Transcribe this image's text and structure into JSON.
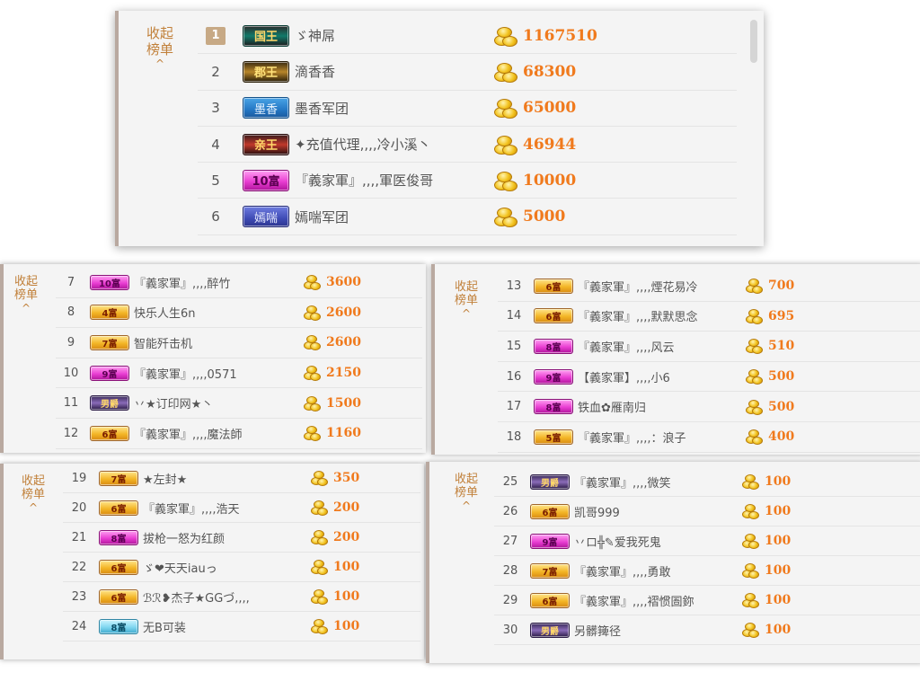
{
  "collapse_label": "收起\n榜单",
  "collapse_text1": "收起",
  "collapse_text2": "榜单",
  "collapse_arrow": "^",
  "colors": {
    "amount": "#f07a1d",
    "rank1_bg": "#c7a985",
    "collapse": "#c1803a"
  },
  "panels": [
    {
      "rows": [
        {
          "rank": "1",
          "badge": "国王",
          "badge_style": "teal",
          "name": "ゞ神屌",
          "amount": "1167510"
        },
        {
          "rank": "2",
          "badge": "郡王",
          "badge_style": "gold2",
          "name": "滴香香",
          "amount": "68300"
        },
        {
          "rank": "3",
          "badge": "墨香",
          "badge_style": "blue",
          "name": "墨香军团",
          "amount": "65000"
        },
        {
          "rank": "4",
          "badge": "亲王",
          "badge_style": "red",
          "name": "✦充值代理,,,,冷小溪丶",
          "amount": "46944"
        },
        {
          "rank": "5",
          "badge": "10富",
          "badge_style": "pink",
          "name": "『義家軍』,,,,軍医俊哥",
          "amount": "10000"
        },
        {
          "rank": "6",
          "badge": "嫣喘",
          "badge_style": "vio",
          "name": "嫣喘军团",
          "amount": "5000"
        }
      ]
    },
    {
      "rows": [
        {
          "rank": "7",
          "badge": "10富",
          "badge_style": "pink",
          "name": "『義家軍』,,,,醉竹",
          "amount": "3600"
        },
        {
          "rank": "8",
          "badge": "4富",
          "badge_style": "gold",
          "name": "快乐人生6n",
          "amount": "2600"
        },
        {
          "rank": "9",
          "badge": "7富",
          "badge_style": "gold",
          "name": "智能歼击机",
          "amount": "2600"
        },
        {
          "rank": "10",
          "badge": "9富",
          "badge_style": "pink",
          "name": "『義家軍』,,,,0571",
          "amount": "2150"
        },
        {
          "rank": "11",
          "badge": "男爵",
          "badge_style": "purp",
          "name": "丷★订印网★丶",
          "amount": "1500"
        },
        {
          "rank": "12",
          "badge": "6富",
          "badge_style": "gold",
          "name": "『義家軍』,,,,魔法師",
          "amount": "1160"
        }
      ]
    },
    {
      "rows": [
        {
          "rank": "13",
          "badge": "6富",
          "badge_style": "gold",
          "name": "『義家軍』,,,,煙花易冷",
          "amount": "700"
        },
        {
          "rank": "14",
          "badge": "6富",
          "badge_style": "gold",
          "name": "『義家軍』,,,,默默思念",
          "amount": "695"
        },
        {
          "rank": "15",
          "badge": "8富",
          "badge_style": "pink",
          "name": "『義家軍』,,,,风云",
          "amount": "510"
        },
        {
          "rank": "16",
          "badge": "9富",
          "badge_style": "pink",
          "name": "【義家軍】,,,,小6",
          "amount": "500"
        },
        {
          "rank": "17",
          "badge": "8富",
          "badge_style": "pink",
          "name": "铁血✿雁南归",
          "amount": "500"
        },
        {
          "rank": "18",
          "badge": "5富",
          "badge_style": "gold",
          "name": "『義家軍』,,,,：浪子",
          "amount": "400"
        }
      ]
    },
    {
      "rows": [
        {
          "rank": "19",
          "badge": "7富",
          "badge_style": "gold",
          "name": "★左封★",
          "amount": "350"
        },
        {
          "rank": "20",
          "badge": "6富",
          "badge_style": "gold",
          "name": "『義家軍』,,,,浩天",
          "amount": "200"
        },
        {
          "rank": "21",
          "badge": "8富",
          "badge_style": "pink",
          "name": "拔枪一怒为红颜",
          "amount": "200"
        },
        {
          "rank": "22",
          "badge": "6富",
          "badge_style": "gold",
          "name": "ゞ❤天天iauっ",
          "amount": "100"
        },
        {
          "rank": "23",
          "badge": "6富",
          "badge_style": "gold",
          "name": "ℬℛ❥杰子★GGづ,,,,",
          "amount": "100"
        },
        {
          "rank": "24",
          "badge": "8富",
          "badge_style": "lblue",
          "name": "无B可装",
          "amount": "100"
        }
      ]
    },
    {
      "rows": [
        {
          "rank": "25",
          "badge": "男爵",
          "badge_style": "purp",
          "name": "『義家軍』,,,,微笑",
          "amount": "100"
        },
        {
          "rank": "26",
          "badge": "6富",
          "badge_style": "gold",
          "name": "凯哥999",
          "amount": "100"
        },
        {
          "rank": "27",
          "badge": "9富",
          "badge_style": "pink",
          "name": "丷ロ╬✎爱我死鬼",
          "amount": "100"
        },
        {
          "rank": "28",
          "badge": "7富",
          "badge_style": "gold",
          "name": "『義家軍』,,,,勇敢",
          "amount": "100"
        },
        {
          "rank": "29",
          "badge": "6富",
          "badge_style": "gold",
          "name": "『義家軍』,,,,褶惯圄鉨",
          "amount": "100"
        },
        {
          "rank": "30",
          "badge": "男爵",
          "badge_style": "purp",
          "name": "另髒篺径",
          "amount": "100"
        }
      ]
    }
  ]
}
